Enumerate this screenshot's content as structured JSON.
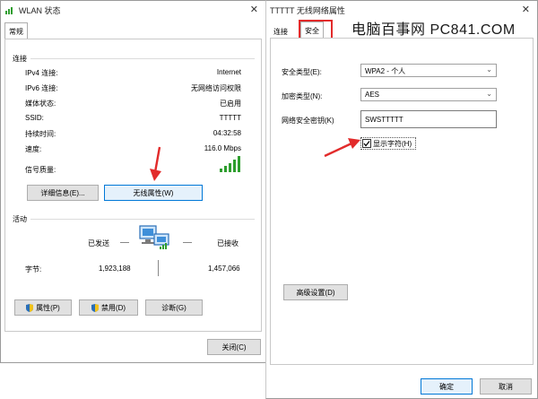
{
  "left_window": {
    "title": "WLAN 状态",
    "close_glyph": "✕",
    "tab": "常规",
    "connection": {
      "header": "连接",
      "rows": [
        {
          "label": "IPv4 连接:",
          "value": "Internet"
        },
        {
          "label": "IPv6 连接:",
          "value": "无网络访问权限"
        },
        {
          "label": "媒体状态:",
          "value": "已启用"
        },
        {
          "label": "SSID:",
          "value": "TTTTT"
        },
        {
          "label": "持续时间:",
          "value": "04:32:58"
        },
        {
          "label": "速度:",
          "value": "116.0 Mbps"
        }
      ],
      "signal_label": "信号质量:",
      "signal_bars": 5,
      "details_button": "详细信息(E)...",
      "wireless_props_button": "无线属性(W)"
    },
    "activity": {
      "header": "活动",
      "sent_label": "已发送",
      "received_label": "已接收",
      "bytes_label": "字节:",
      "bytes_sent": "1,923,188",
      "bytes_received": "1,457,066"
    },
    "buttons": {
      "properties": "属性(P)",
      "disable": "禁用(D)",
      "diagnose": "诊断(G)",
      "close": "关闭(C)"
    }
  },
  "right_window": {
    "title": "TTTTT 无线网络属性",
    "close_glyph": "✕",
    "tabs": [
      "连接",
      "安全"
    ],
    "security_type_label": "安全类型(E):",
    "security_type_value": "WPA2 - 个人",
    "encryption_label": "加密类型(N):",
    "encryption_value": "AES",
    "key_label": "网络安全密钥(K)",
    "key_value": "SWSTTTTT",
    "show_chars_label": "显示字符(H)",
    "show_chars_checked": true,
    "advanced_button": "高级设置(D)",
    "ok_button": "确定",
    "cancel_button": "取消"
  },
  "watermark": "电脑百事网 PC841.COM",
  "colors": {
    "highlight_red": "#e22b2b",
    "signal_green": "#2e9e2e",
    "accent_blue": "#0078d7"
  }
}
